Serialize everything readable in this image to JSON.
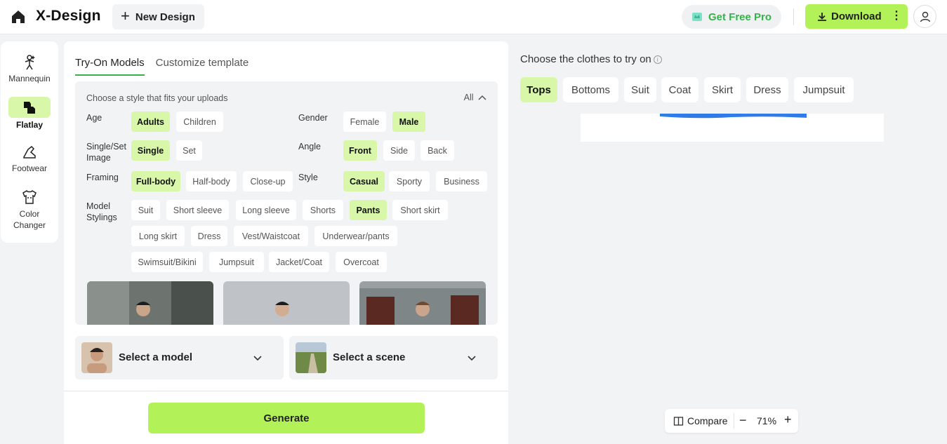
{
  "header": {
    "brand": "X-Design",
    "new_design": "New Design",
    "get_pro": "Get Free Pro",
    "download": "Download"
  },
  "rail": [
    {
      "label": "Mannequin"
    },
    {
      "label": "Flatlay"
    },
    {
      "label": "Footwear"
    },
    {
      "label": "Color Changer"
    }
  ],
  "tabs": {
    "try_on": "Try-On Models",
    "customize": "Customize template"
  },
  "filters": {
    "title": "Choose a style that fits your uploads",
    "all": "All",
    "age": {
      "label": "Age",
      "options": [
        "Adults",
        "Children"
      ]
    },
    "gender": {
      "label": "Gender",
      "options": [
        "Female",
        "Male"
      ]
    },
    "image": {
      "label": "Single/Set Image",
      "options": [
        "Single",
        "Set"
      ]
    },
    "angle": {
      "label": "Angle",
      "options": [
        "Front",
        "Side",
        "Back"
      ]
    },
    "framing": {
      "label": "Framing",
      "options": [
        "Full-body",
        "Half-body",
        "Close-up"
      ]
    },
    "style": {
      "label": "Style",
      "options": [
        "Casual",
        "Sporty",
        "Business"
      ]
    },
    "stylings": {
      "label": "Model Stylings",
      "options": [
        "Suit",
        "Short sleeve",
        "Long sleeve",
        "Shorts",
        "Pants",
        "Short skirt",
        "Long skirt",
        "Dress",
        "Vest/Waistcoat",
        "Underwear/pants",
        "Swimsuit/Bikini",
        "Jumpsuit",
        "Jacket/Coat",
        "Overcoat"
      ]
    }
  },
  "pickers": {
    "model": "Select a model",
    "scene": "Select a scene"
  },
  "generate": "Generate",
  "clothes": {
    "title": "Choose the clothes to try on",
    "tabs": [
      "Tops",
      "Bottoms",
      "Suit",
      "Coat",
      "Skirt",
      "Dress",
      "Jumpsuit"
    ]
  },
  "zoom": {
    "compare": "Compare",
    "value": "71%"
  },
  "colors": {
    "accent": "#b3f158",
    "selected_chip": "#d8f7a8",
    "pro_green": "#36b24a",
    "stroke_blue": "#2f7be8"
  }
}
